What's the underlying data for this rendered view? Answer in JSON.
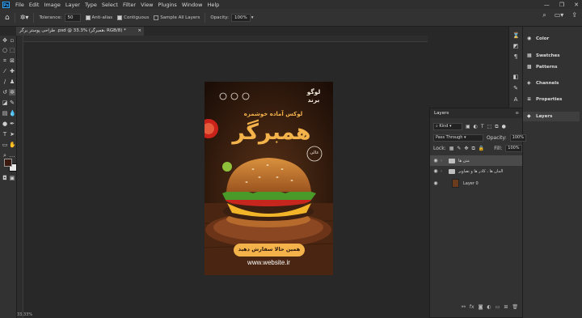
{
  "app": {
    "logo": "Ps"
  },
  "menu": [
    "File",
    "Edit",
    "Image",
    "Layer",
    "Type",
    "Select",
    "Filter",
    "View",
    "Plugins",
    "Window",
    "Help"
  ],
  "window_controls": [
    "—",
    "❐",
    "✕"
  ],
  "options": {
    "tolerance_label": "Tolerance:",
    "tolerance_value": "50",
    "anti_alias": "Anti-alias",
    "contiguous": "Contiguous",
    "sample_all_layers": "Sample All Layers",
    "opacity_label": "Opacity:",
    "opacity_value": "100%"
  },
  "document_tab": {
    "title": "طراحی پوستر برگر .psd @ 33.3% (همبرگر، RGB/8) *",
    "close": "×"
  },
  "poster": {
    "logo_line1": "لوگو",
    "logo_line2": "برند",
    "subtitle": "لوکس آماده خوشمزه",
    "title": "همبرگر",
    "badge": "عالی",
    "cta": "همین حالا سفارش دهید",
    "website": "www.website.ir",
    "bg_color": "#2b170d",
    "accent_color": "#f3b24a"
  },
  "right_nav": {
    "items": [
      {
        "label": "Color",
        "icon": "color-icon"
      },
      {
        "label": "Swatches",
        "icon": "swatches-icon"
      },
      {
        "label": "Patterns",
        "icon": "patterns-icon"
      },
      {
        "label": "Channels",
        "icon": "channels-icon"
      },
      {
        "label": "Properties",
        "icon": "properties-icon"
      },
      {
        "label": "Layers",
        "icon": "layers-icon"
      }
    ]
  },
  "layers_panel": {
    "title": "Layers",
    "filter_kind": "Kind",
    "blend_mode": "Pass Through",
    "opacity_label": "Opacity:",
    "opacity_value": "100%",
    "lock_label": "Lock:",
    "fill_label": "Fill:",
    "fill_value": "100%",
    "layers": [
      {
        "name": "متن ها",
        "type": "group",
        "selected": true
      },
      {
        "name": "المان ها ، کادر ها و تصاویر",
        "type": "group",
        "selected": false
      },
      {
        "name": "Layer 0",
        "type": "pixel",
        "selected": false
      }
    ]
  },
  "status": {
    "zoom": "33.33%"
  }
}
